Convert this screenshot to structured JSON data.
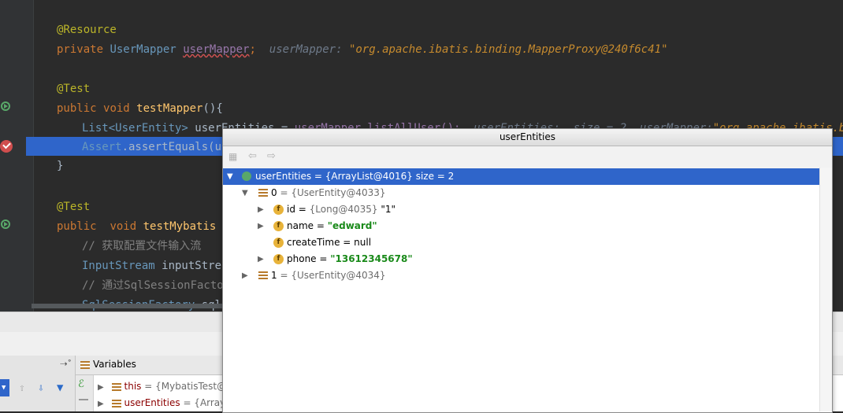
{
  "editor": {
    "line1": "@Resource",
    "line2": {
      "kw": "private",
      "type": "UserMapper",
      "var": "userMapper",
      "semi": ";",
      "dbg_label": "userMapper:",
      "dbg_val": "\"org.apache.ibatis.binding.MapperProxy@240f6c41\""
    },
    "line3": "@Test",
    "line4": {
      "kw1": "public",
      "kw2": "void",
      "fn": "testMapper",
      "rest": "(){"
    },
    "line5": {
      "type": "List<UserEntity>",
      "text": " userEntities = ",
      "dim": "userMapper.listAllUser();",
      "dbg": "  userEntities:  size = 2  userMapper:",
      "dbgstr": "\"org.apache.ibatis.bindin"
    },
    "line6": {
      "cls": "Assert",
      "text": ".assertEquals(us"
    },
    "line7": "}",
    "line8": "@Test",
    "line9": {
      "kw1": "public",
      "kw2": "void",
      "fn": "testMybatis",
      "rest": " ("
    },
    "line10": "// 获取配置文件输入流",
    "line11": {
      "type": "InputStream",
      "text": " inputStrea"
    },
    "line12": "// 通过SqlSessionFacto",
    "line13": {
      "type": "SqlSessionFactory",
      "text": " sqlS"
    }
  },
  "variables_panel": {
    "title": "Variables",
    "pin": "⇢˚",
    "rows": [
      {
        "name": "this",
        "value": "= {MybatisTest@"
      },
      {
        "name": "userEntities",
        "value": "= {Array"
      }
    ]
  },
  "popup": {
    "title": "userEntities",
    "root": {
      "name": "userEntities",
      "value": "= {ArrayList@4016}  size = 2"
    },
    "item0": {
      "name": "0",
      "value": "= {UserEntity@4033}"
    },
    "fields": [
      {
        "name": "id",
        "eq": " = ",
        "type": "{Long@4035}",
        "value": "\"1\"",
        "expandable": true
      },
      {
        "name": "name",
        "eq": " = ",
        "type": "",
        "value": "\"edward\"",
        "expandable": true
      },
      {
        "name": "createTime",
        "eq": " = ",
        "type": "",
        "value": "null",
        "expandable": false
      },
      {
        "name": "phone",
        "eq": " = ",
        "type": "",
        "value": "\"13612345678\"",
        "expandable": true
      }
    ],
    "item1": {
      "name": "1",
      "value": "= {UserEntity@4034}"
    }
  },
  "colors": {
    "selection": "#2f65ca",
    "editor_bg": "#2b2b2b",
    "breakpoint": "#d04e4e"
  }
}
